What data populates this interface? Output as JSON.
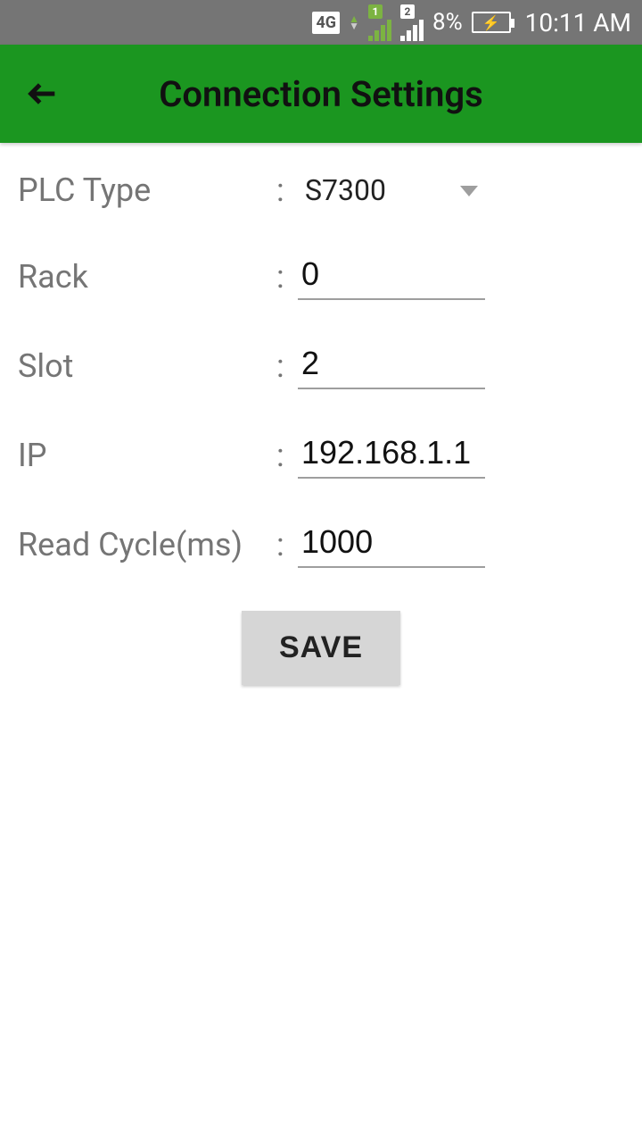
{
  "status": {
    "network_label": "4G",
    "sim1_badge": "1",
    "sim2_badge": "2",
    "battery_pct": "8%",
    "time": "10:11 AM"
  },
  "header": {
    "title": "Connection Settings"
  },
  "form": {
    "plc_type": {
      "label": "PLC Type",
      "value": "S7300"
    },
    "rack": {
      "label": "Rack",
      "value": "0"
    },
    "slot": {
      "label": "Slot",
      "value": "2"
    },
    "ip": {
      "label": "IP",
      "value": "192.168.1.1"
    },
    "read_cycle": {
      "label": "Read Cycle(ms)",
      "value": "1000"
    },
    "save_label": "SAVE"
  }
}
